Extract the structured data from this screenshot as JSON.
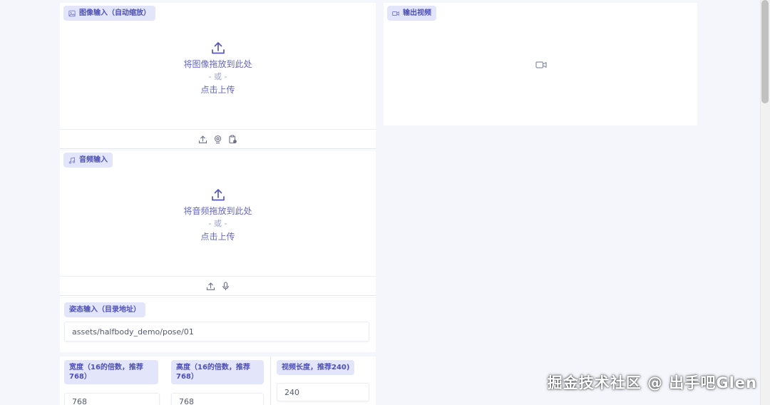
{
  "image_input": {
    "label": "图像输入（自动缩放）",
    "drop_text": "将图像拖放到此处",
    "or_text": "- 或 -",
    "click_text": "点击上传"
  },
  "audio_input": {
    "label": "音频输入",
    "drop_text": "将音频拖放到此处",
    "or_text": "- 或 -",
    "click_text": "点击上传"
  },
  "pose_input": {
    "label": "姿态输入（目录地址）",
    "value": "assets/halfbody_demo/pose/01"
  },
  "width_input": {
    "label": "宽度（16的倍数，推荐768）",
    "value": "768"
  },
  "height_input": {
    "label": "高度（16的倍数，推荐768）",
    "value": "768"
  },
  "length_input": {
    "label": "视频长度，推荐240)",
    "value": "240"
  },
  "output_video": {
    "label": "输出视频"
  },
  "watermark": "掘金技术社区 @ 出手吧Glen",
  "colors": {
    "label_bg": "#e3e5fb",
    "label_text": "#4c4fb6",
    "accent": "#6468b9",
    "page_bg": "#f4f6fb"
  }
}
